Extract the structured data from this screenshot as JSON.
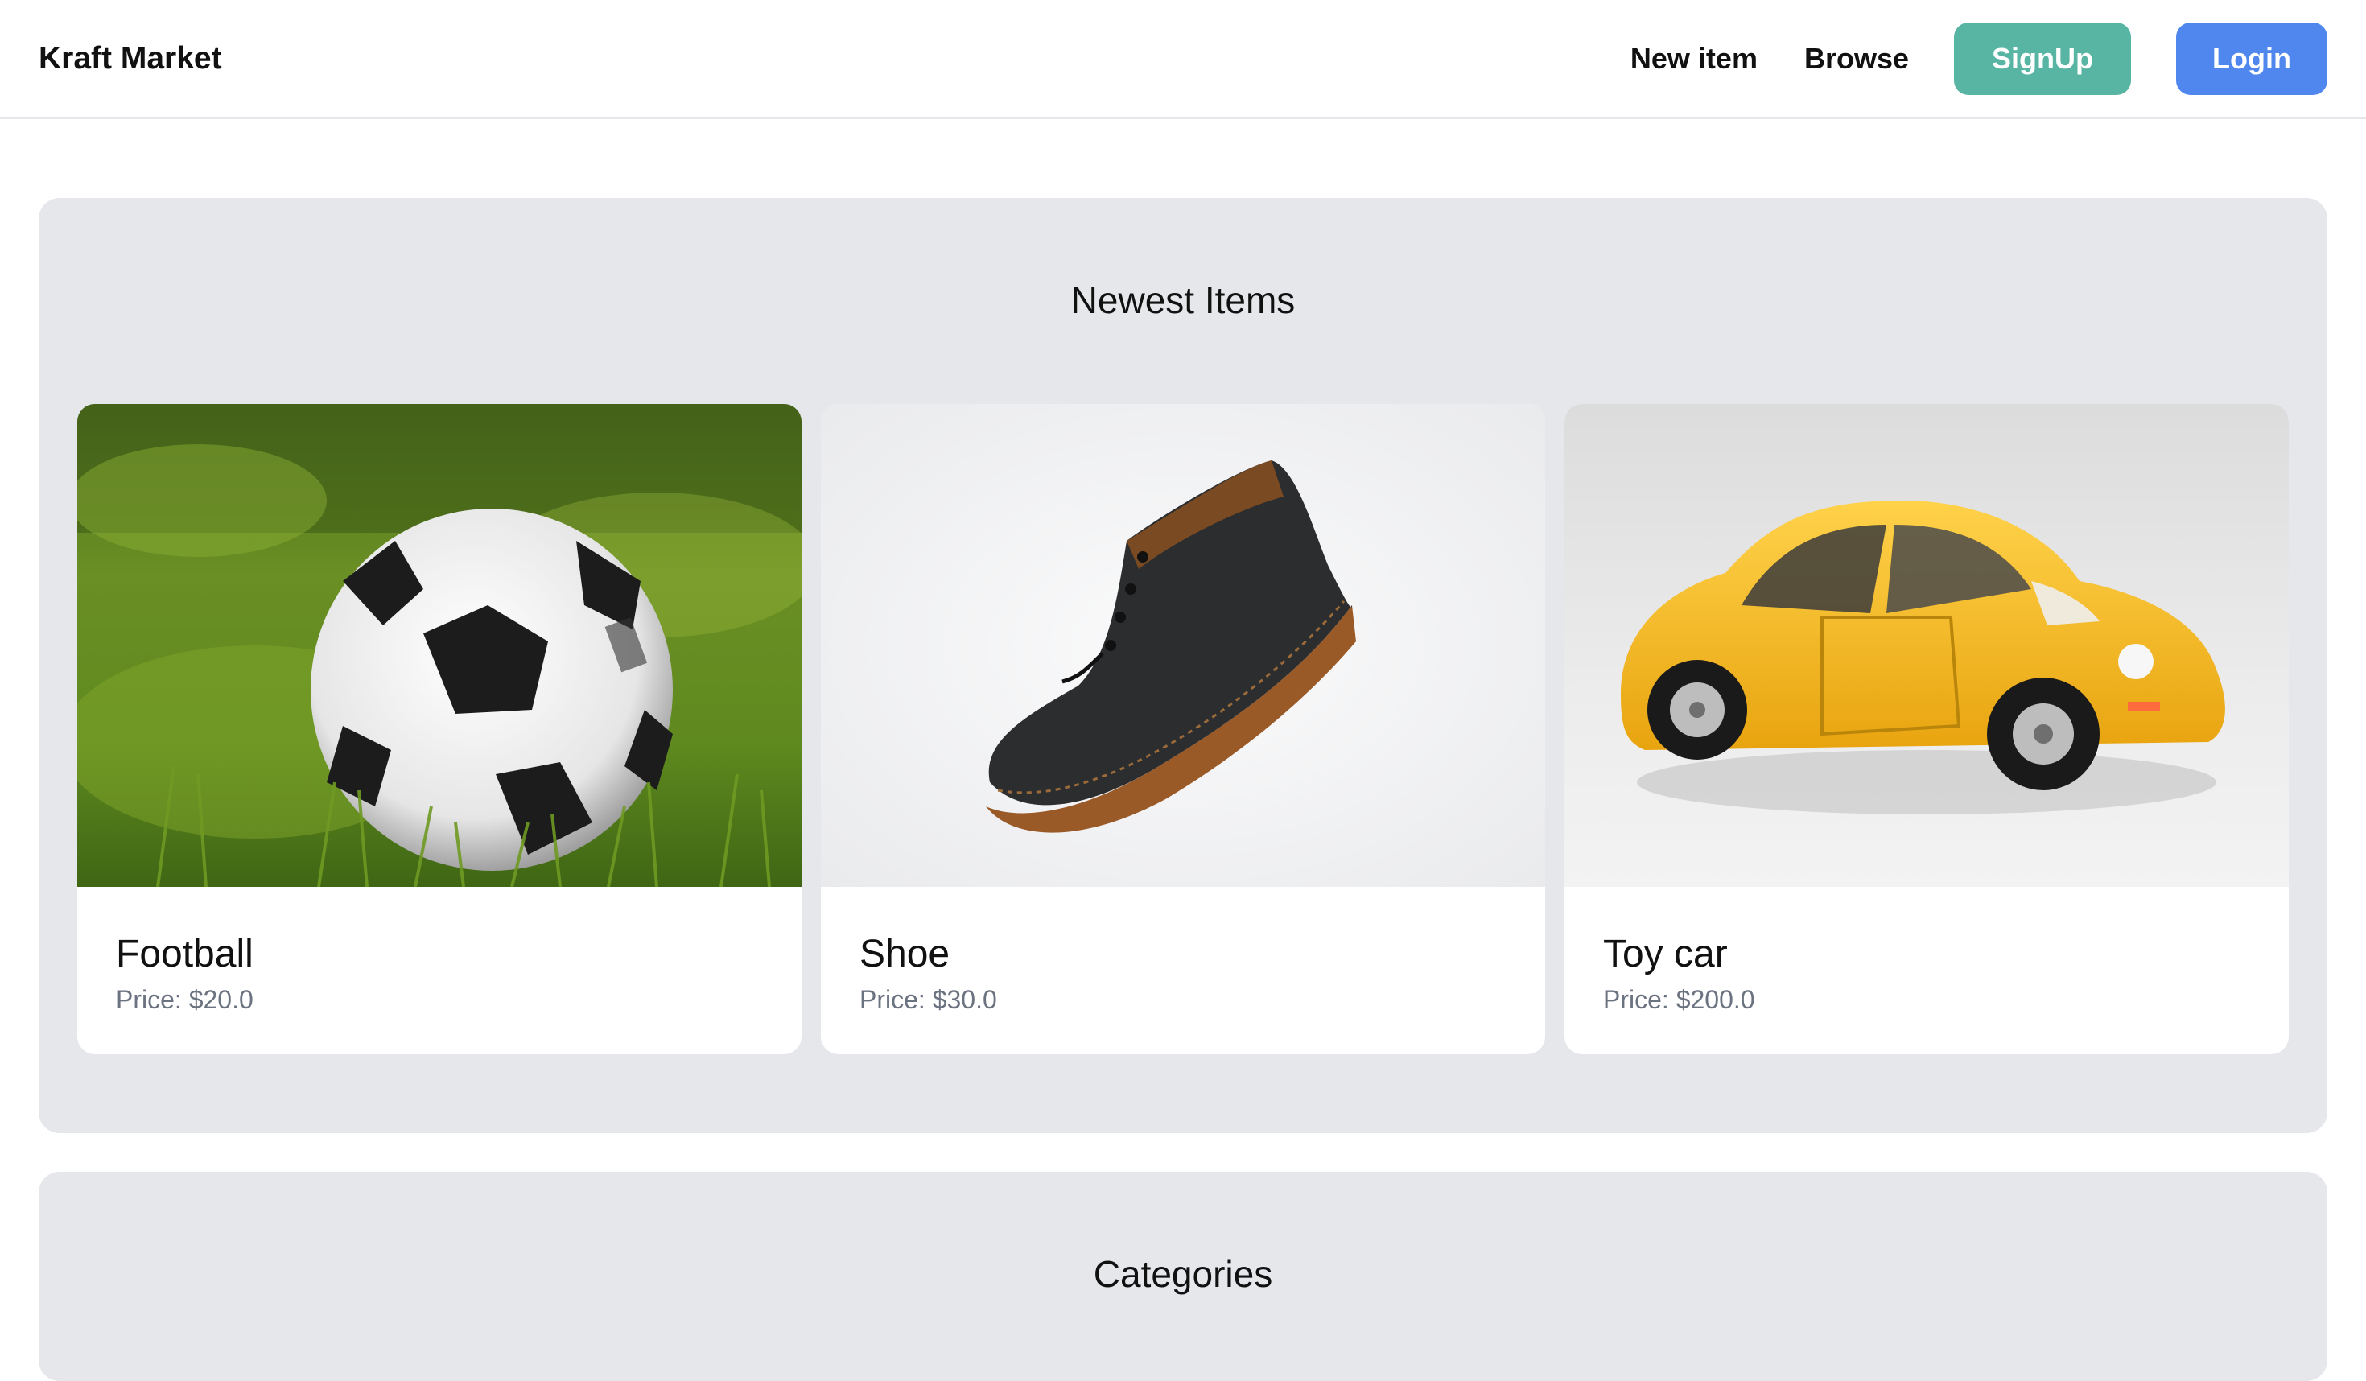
{
  "navbar": {
    "brand": "Kraft Market",
    "new_item": "New item",
    "browse": "Browse",
    "signup": "SignUp",
    "login": "Login"
  },
  "colors": {
    "signup_button": "#58b5a3",
    "login_button": "#4f87ee",
    "section_bg": "#e5e7eb"
  },
  "newest": {
    "title": "Newest Items",
    "items": [
      {
        "name": "Football",
        "price": "Price: $20.0",
        "image": "football-photo"
      },
      {
        "name": "Shoe",
        "price": "Price: $30.0",
        "image": "shoe-photo"
      },
      {
        "name": "Toy car",
        "price": "Price: $200.0",
        "image": "toy-car-photo"
      }
    ]
  },
  "categories": {
    "title": "Categories"
  }
}
